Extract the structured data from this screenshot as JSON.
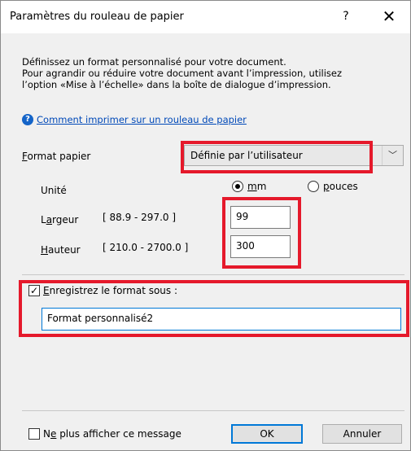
{
  "window": {
    "title": "Paramètres du rouleau de papier",
    "help_glyph": "?",
    "close_glyph": "✕"
  },
  "description": {
    "line1": "Définissez un format personnalisé pour votre document.",
    "line2": "Pour agrandir ou réduire votre document avant l’impression, utilisez",
    "line3": "l’option «Mise à l’échelle» dans la boîte de dialogue d’impression."
  },
  "help_link": {
    "icon": "question-circle-icon",
    "label": "Comment imprimer sur un rouleau de papier"
  },
  "paper_format": {
    "label_mnemonic": "F",
    "label_rest": "ormat papier",
    "selected": "Définie par l’utilisateur",
    "chevron_glyph": "﹀"
  },
  "unit": {
    "label": "Unité",
    "options": [
      {
        "mnemonic": "m",
        "rest": "m",
        "selected": true
      },
      {
        "mnemonic": "p",
        "rest": "ouces",
        "selected": false
      }
    ]
  },
  "width": {
    "label_start": "L",
    "label_mnemonic": "a",
    "label_rest": "rgeur",
    "range": "[ 88.9 - 297.0 ]",
    "value": "99"
  },
  "height": {
    "label_mnemonic": "H",
    "label_rest": "auteur",
    "range": "[ 210.0 - 2700.0 ]",
    "value": "300"
  },
  "save_format": {
    "checked": true,
    "check_glyph": "✓",
    "label_mnemonic": "E",
    "label_rest": "nregistrez le format sous :",
    "name_value": "Format personnalisé2"
  },
  "footer": {
    "dont_show_mnemonic_pre": "N",
    "dont_show_mnemonic": "e",
    "dont_show_rest": " plus afficher ce message",
    "dont_show_checked": false,
    "ok_label": "OK",
    "cancel_label": "Annuler"
  },
  "colors": {
    "highlight": "#e5192b",
    "link": "#0049b8",
    "accent": "#0078d7"
  }
}
